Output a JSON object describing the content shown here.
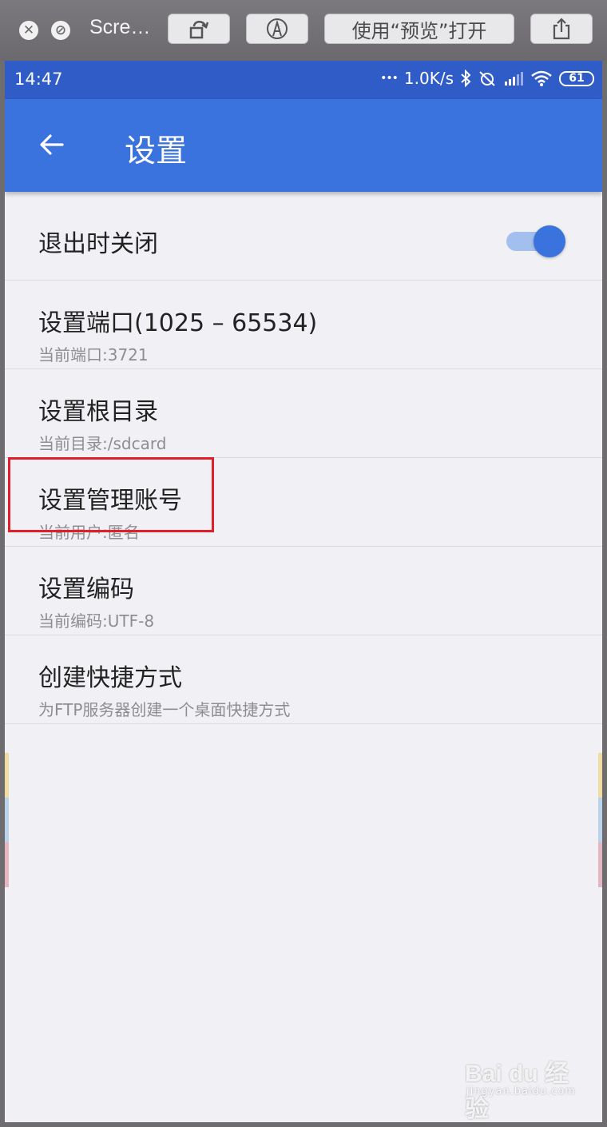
{
  "quicklook": {
    "title": "Scre…",
    "open_button": "使用“预览”打开"
  },
  "statusbar": {
    "time": "14:47",
    "dots": "•••",
    "speed": "1.0K/s",
    "battery": "61"
  },
  "appbar": {
    "title": "设置"
  },
  "settings": [
    {
      "title": "退出时关闭",
      "subtitle": "",
      "toggle_on": true
    },
    {
      "title": "设置端口(1025 – 65534)",
      "subtitle": "当前端口:3721"
    },
    {
      "title": "设置根目录",
      "subtitle": "当前目录:/sdcard"
    },
    {
      "title": "设置管理账号",
      "subtitle": "当前用户:匿名"
    },
    {
      "title": "设置编码",
      "subtitle": "当前编码:UTF-8"
    },
    {
      "title": "创建快捷方式",
      "subtitle": "为FTP服务器创建一个桌面快捷方式"
    }
  ],
  "watermark": {
    "main": "Bai du 经验",
    "sub": "jingyan.baidu.com"
  },
  "colors": {
    "statusbar": "#2f5cc7",
    "appbar": "#3a73de",
    "highlight": "#e01f2a"
  }
}
